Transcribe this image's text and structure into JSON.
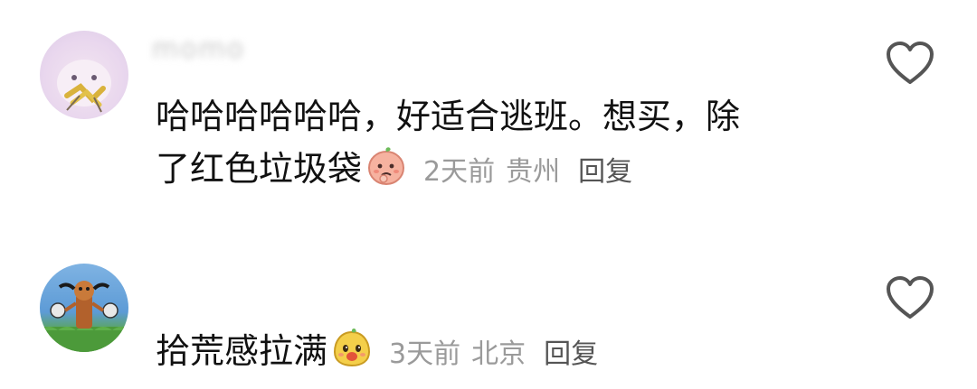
{
  "comments": [
    {
      "username": "momo",
      "text_line1": "哈哈哈哈哈哈，好适合逃班。想买，除",
      "text_line2": "了红色垃圾袋",
      "emoji": "peach-face-emoji",
      "time": "2天前",
      "location": "贵州",
      "reply_label": "回复",
      "like_icon": "heart-outline-icon"
    },
    {
      "username": "",
      "text_line1": "拾荒感拉满",
      "emoji": "yellow-blob-emoji",
      "time": "3天前",
      "location": "北京",
      "reply_label": "回复",
      "like_icon": "heart-outline-icon"
    }
  ],
  "colors": {
    "text": "#111111",
    "meta": "#9a9a9a",
    "reply": "#555555",
    "icon": "#555555"
  }
}
